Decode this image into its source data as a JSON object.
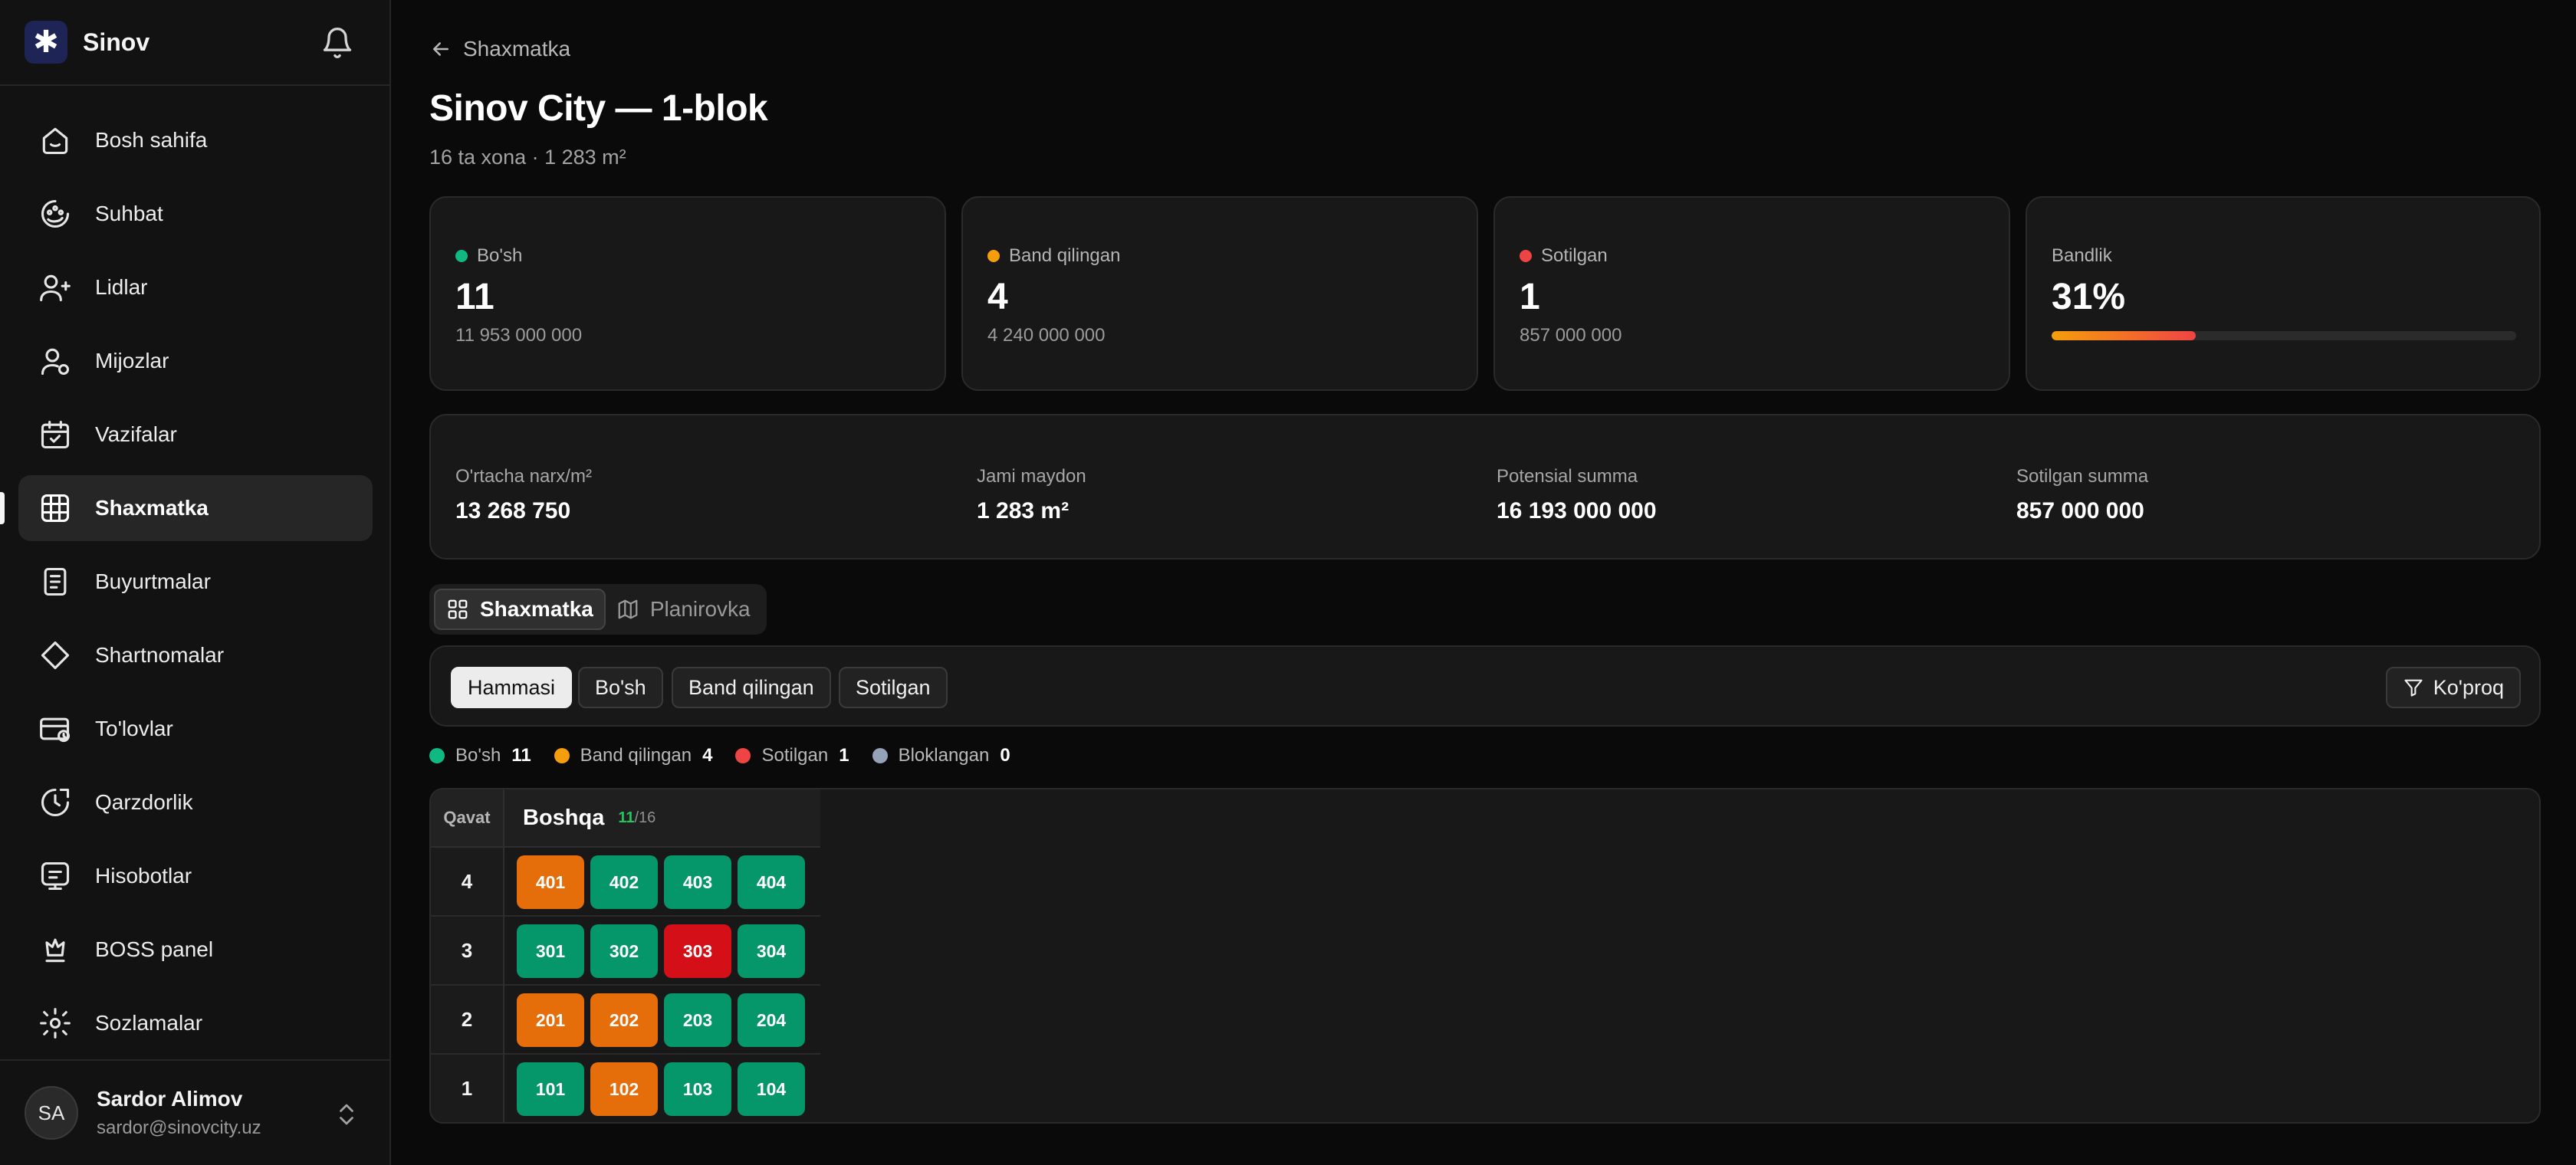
{
  "brand": {
    "name": "Sinov",
    "logo_glyph": "✱",
    "logo_bg": "#1f2457"
  },
  "sidebar": {
    "items": [
      {
        "label": "Bosh sahifa",
        "icon": "home-icon"
      },
      {
        "label": "Suhbat",
        "icon": "chat-icon"
      },
      {
        "label": "Lidlar",
        "icon": "leads-icon"
      },
      {
        "label": "Mijozlar",
        "icon": "clients-icon"
      },
      {
        "label": "Vazifalar",
        "icon": "calendar-check-icon"
      },
      {
        "label": "Shaxmatka",
        "icon": "grid-globe-icon",
        "active": true
      },
      {
        "label": "Buyurtmalar",
        "icon": "receipt-icon"
      },
      {
        "label": "Shartnomalar",
        "icon": "diamond-icon"
      },
      {
        "label": "To'lovlar",
        "icon": "card-clock-icon"
      },
      {
        "label": "Qarzdorlik",
        "icon": "debt-clock-icon"
      },
      {
        "label": "Hisobotlar",
        "icon": "report-icon"
      },
      {
        "label": "BOSS panel",
        "icon": "crown-icon"
      },
      {
        "label": "Sozlamalar",
        "icon": "gear-icon"
      }
    ],
    "user": {
      "initials": "SA",
      "name": "Sardor Alimov",
      "email": "sardor@sinovcity.uz"
    }
  },
  "header": {
    "back_label": "Shaxmatka",
    "title": "Sinov City — 1-blok",
    "subtitle": "16 ta xona · 1 283 m²"
  },
  "stats": [
    {
      "label": "Bo'sh",
      "value": "11",
      "amount": "11 953 000 000",
      "color": "#10b981"
    },
    {
      "label": "Band qilingan",
      "value": "4",
      "amount": "4 240 000 000",
      "color": "#f59e0b"
    },
    {
      "label": "Sotilgan",
      "value": "1",
      "amount": "857 000 000",
      "color": "#ef4444"
    }
  ],
  "occupancy": {
    "label": "Bandlik",
    "value": "31%",
    "fraction": 0.31
  },
  "metrics": [
    {
      "label": "O'rtacha narx/m²",
      "value": "13 268 750"
    },
    {
      "label": "Jami maydon",
      "value": "1 283 m²"
    },
    {
      "label": "Potensial summa",
      "value": "16 193 000 000"
    },
    {
      "label": "Sotilgan summa",
      "value": "857 000 000"
    }
  ],
  "view_tabs": [
    {
      "label": "Shaxmatka",
      "icon": "grid-icon",
      "active": true
    },
    {
      "label": "Planirovka",
      "icon": "map-icon",
      "active": false
    }
  ],
  "filters": {
    "chips": [
      {
        "label": "Hammasi",
        "active": true
      },
      {
        "label": "Bo'sh",
        "active": false
      },
      {
        "label": "Band qilingan",
        "active": false
      },
      {
        "label": "Sotilgan",
        "active": false
      }
    ],
    "more_label": "Ko'proq"
  },
  "legend": [
    {
      "label": "Bo'sh",
      "count": "11",
      "color": "#10b981"
    },
    {
      "label": "Band qilingan",
      "count": "4",
      "color": "#f59e0b"
    },
    {
      "label": "Sotilgan",
      "count": "1",
      "color": "#ef4444"
    },
    {
      "label": "Bloklangan",
      "count": "0",
      "color": "#94a3b8"
    }
  ],
  "grid": {
    "floor_header": "Qavat",
    "section_name": "Boshqa",
    "section_free": "11",
    "section_total": "/16",
    "status_colors": {
      "free": "#059669",
      "reserved": "#e56d0a",
      "sold": "#d40f17"
    },
    "floors": [
      {
        "floor": "4",
        "units": [
          {
            "no": "401",
            "status": "reserved"
          },
          {
            "no": "402",
            "status": "free"
          },
          {
            "no": "403",
            "status": "free"
          },
          {
            "no": "404",
            "status": "free"
          }
        ]
      },
      {
        "floor": "3",
        "units": [
          {
            "no": "301",
            "status": "free"
          },
          {
            "no": "302",
            "status": "free"
          },
          {
            "no": "303",
            "status": "sold"
          },
          {
            "no": "304",
            "status": "free"
          }
        ]
      },
      {
        "floor": "2",
        "units": [
          {
            "no": "201",
            "status": "reserved"
          },
          {
            "no": "202",
            "status": "reserved"
          },
          {
            "no": "203",
            "status": "free"
          },
          {
            "no": "204",
            "status": "free"
          }
        ]
      },
      {
        "floor": "1",
        "units": [
          {
            "no": "101",
            "status": "free"
          },
          {
            "no": "102",
            "status": "reserved"
          },
          {
            "no": "103",
            "status": "free"
          },
          {
            "no": "104",
            "status": "free"
          }
        ]
      }
    ]
  }
}
